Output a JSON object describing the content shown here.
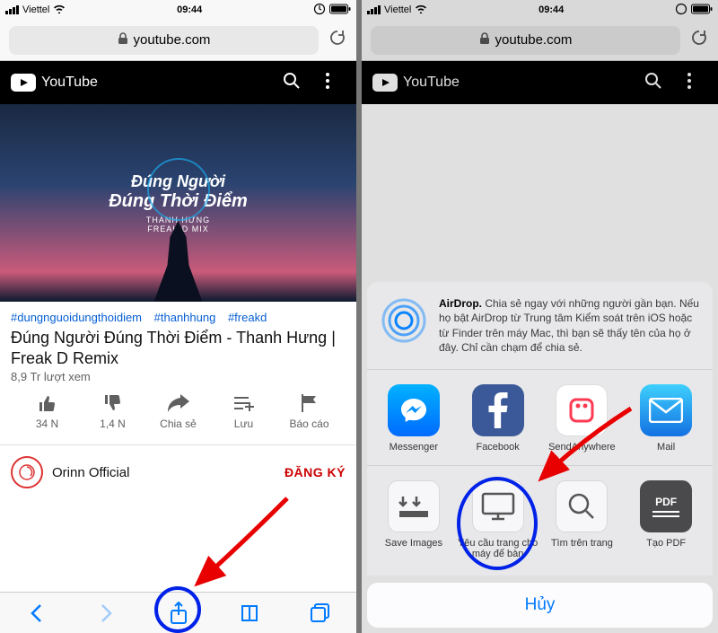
{
  "status": {
    "carrier": "Viettel",
    "time": "09:44"
  },
  "url": {
    "host": "youtube.com"
  },
  "yt": {
    "brand": "YouTube"
  },
  "thumb": {
    "line1": "Đúng Người",
    "line2": "Đúng Thời Điểm",
    "line3": "THANH HƯNG",
    "line4": "FREAK D MIX"
  },
  "hashtags": [
    "#dungnguoidungthoidiem",
    "#thanhhung",
    "#freakd"
  ],
  "video": {
    "title": "Đúng Người Đúng Thời Điểm - Thanh Hưng | Freak D Remix",
    "views": "8,9 Tr lượt xem"
  },
  "actions": {
    "like": "34 N",
    "dislike": "1,4 N",
    "share": "Chia sẻ",
    "save": "Lưu",
    "report": "Báo cáo"
  },
  "channel": {
    "name": "Orinn Official",
    "subscribe": "ĐĂNG KÝ"
  },
  "airdrop": {
    "title": "AirDrop.",
    "desc": "Chia sẻ ngay với những người gần bạn. Nếu họ bật AirDrop từ Trung tâm Kiểm soát trên iOS hoặc từ Finder trên máy Mac, thì bạn sẽ thấy tên của họ ở đây. Chỉ cần chạm để chia sẻ."
  },
  "apps": [
    {
      "name": "Messenger"
    },
    {
      "name": "Facebook"
    },
    {
      "name": "SendAnywhere"
    },
    {
      "name": "Mail"
    }
  ],
  "sheetActions": [
    {
      "name": "Save Images"
    },
    {
      "name": "Yêu cầu trang cho máy để bàn"
    },
    {
      "name": "Tìm trên trang"
    },
    {
      "name": "Tạo PDF"
    }
  ],
  "cancel": "Hủy"
}
